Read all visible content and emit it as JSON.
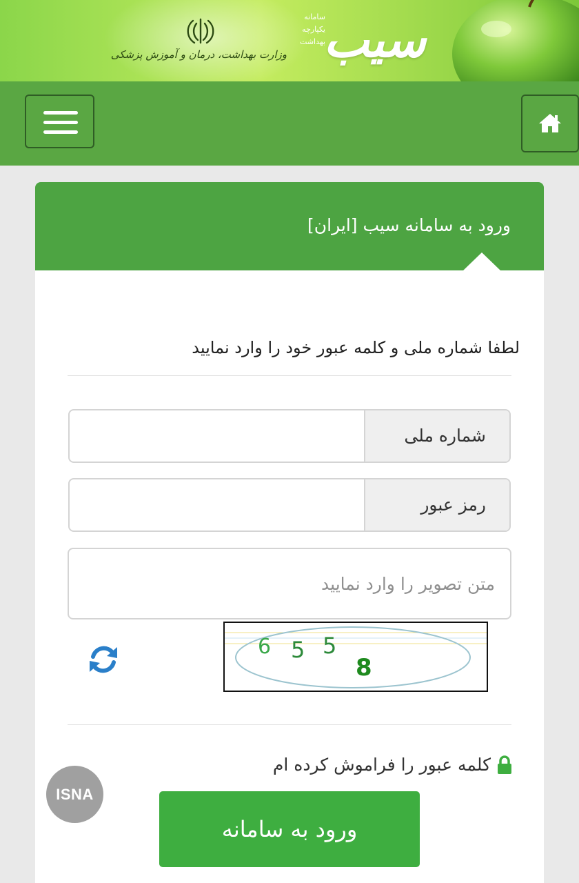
{
  "header": {
    "ministry_text": "وزارت بهداشت، درمان و آموزش پزشکی",
    "system_lines": [
      "سامانه",
      "یکپارچه",
      "بهداشت"
    ],
    "logo_text": "سیب"
  },
  "panel": {
    "title": "ورود به سامانه سیب [ایران]",
    "instruction": "لطفا شماره ملی و کلمه عبور خود را وارد نمایید"
  },
  "form": {
    "national_id_label": "شماره ملی",
    "national_id_value": "",
    "password_label": "رمز عبور",
    "password_value": "",
    "captcha_placeholder": "متن تصویر را وارد نمایید",
    "captcha_digits": [
      "6",
      "5",
      "5",
      "8"
    ],
    "forgot_password": "کلمه عبور را فراموش کرده ام",
    "submit_label": "ورود به سامانه"
  },
  "watermark": {
    "text": "ISNA"
  },
  "colors": {
    "primary_green": "#4da442",
    "nav_green": "#5aa743",
    "button_green": "#3eae40",
    "refresh_blue": "#2a7fc9"
  }
}
